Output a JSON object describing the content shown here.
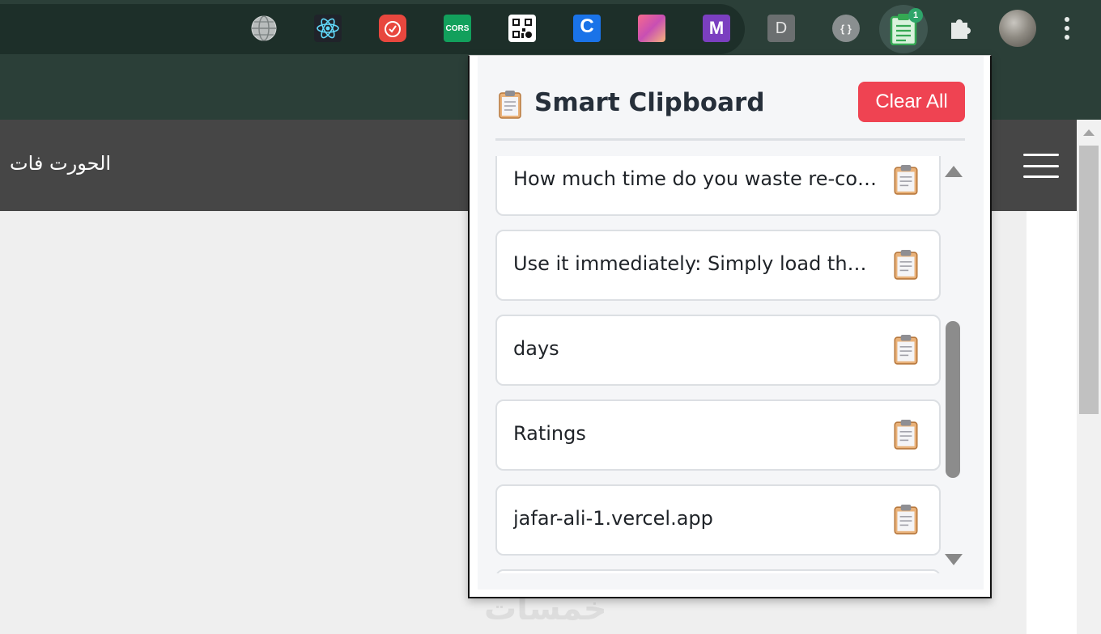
{
  "toolbar": {
    "extensions": [
      {
        "name": "globe",
        "label": ""
      },
      {
        "name": "react",
        "label": ""
      },
      {
        "name": "timer",
        "label": ""
      },
      {
        "name": "cors",
        "label": "CORS"
      },
      {
        "name": "qr",
        "label": ""
      },
      {
        "name": "c",
        "label": "C"
      },
      {
        "name": "gradient",
        "label": ""
      },
      {
        "name": "m",
        "label": "M"
      },
      {
        "name": "d",
        "label": "D"
      },
      {
        "name": "code",
        "label": "{ }"
      }
    ],
    "clipboard_badge": "1",
    "colors": {
      "toolbar": "#2b3f38",
      "strip": "#1d2f29"
    }
  },
  "page": {
    "nav_title": "الحورت فات",
    "watermark": "خمسات"
  },
  "popup": {
    "title": "Smart Clipboard",
    "clear_label": "Clear All",
    "items": [
      {
        "text": "How much time do you waste re-copying the same text?"
      },
      {
        "text": "Use it immediately: Simply load the extension"
      },
      {
        "text": "days"
      },
      {
        "text": "Ratings"
      },
      {
        "text": "jafar-ali-1.vercel.app"
      }
    ],
    "colors": {
      "clear_button": "#ef4352",
      "title": "#262f3a"
    }
  }
}
